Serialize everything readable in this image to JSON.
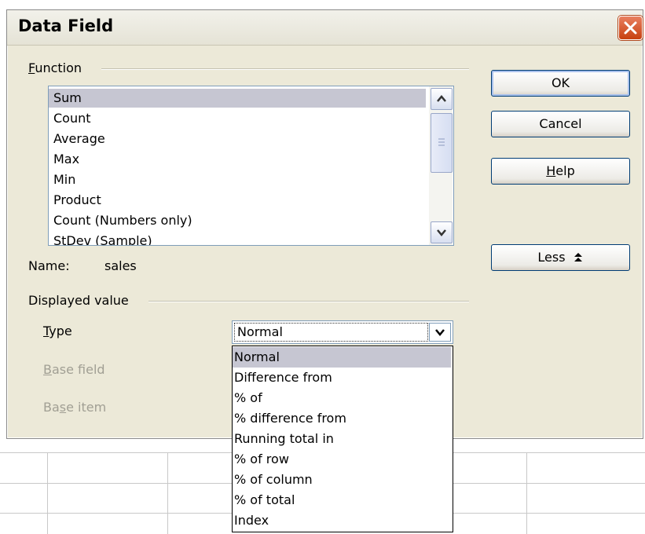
{
  "dialog": {
    "title": "Data Field"
  },
  "function_group": {
    "label_prefix": "",
    "label_mnemonic": "F",
    "label_rest": "unction",
    "items": [
      "Sum",
      "Count",
      "Average",
      "Max",
      "Min",
      "Product",
      "Count (Numbers only)",
      "StDev (Sample)"
    ],
    "selected": "Sum"
  },
  "name_row": {
    "label": "Name:",
    "value": "sales"
  },
  "displayed_value": {
    "label": "Displayed value",
    "type_label_mnemonic": "T",
    "type_label_rest": "ype",
    "type_value": "Normal",
    "base_field_mnemonic": "B",
    "base_field_rest": "ase field",
    "base_item_pre": "Ba",
    "base_item_mnemonic": "s",
    "base_item_rest": "e item"
  },
  "buttons": {
    "ok": "OK",
    "cancel": "Cancel",
    "help_mnemonic": "H",
    "help_rest": "elp",
    "less": "Less",
    "less_icon": "double-chevron-up-icon"
  },
  "type_dropdown": {
    "options": [
      "Normal",
      "Difference from",
      "% of",
      "% difference from",
      "Running total in",
      "% of row",
      "% of column",
      "% of total",
      "Index"
    ],
    "highlighted": "Normal"
  },
  "colors": {
    "dialog_bg": "#ece9d8",
    "selection": "#c6c6d2",
    "close_button": "#c7400f",
    "button_border": "#003c74"
  }
}
